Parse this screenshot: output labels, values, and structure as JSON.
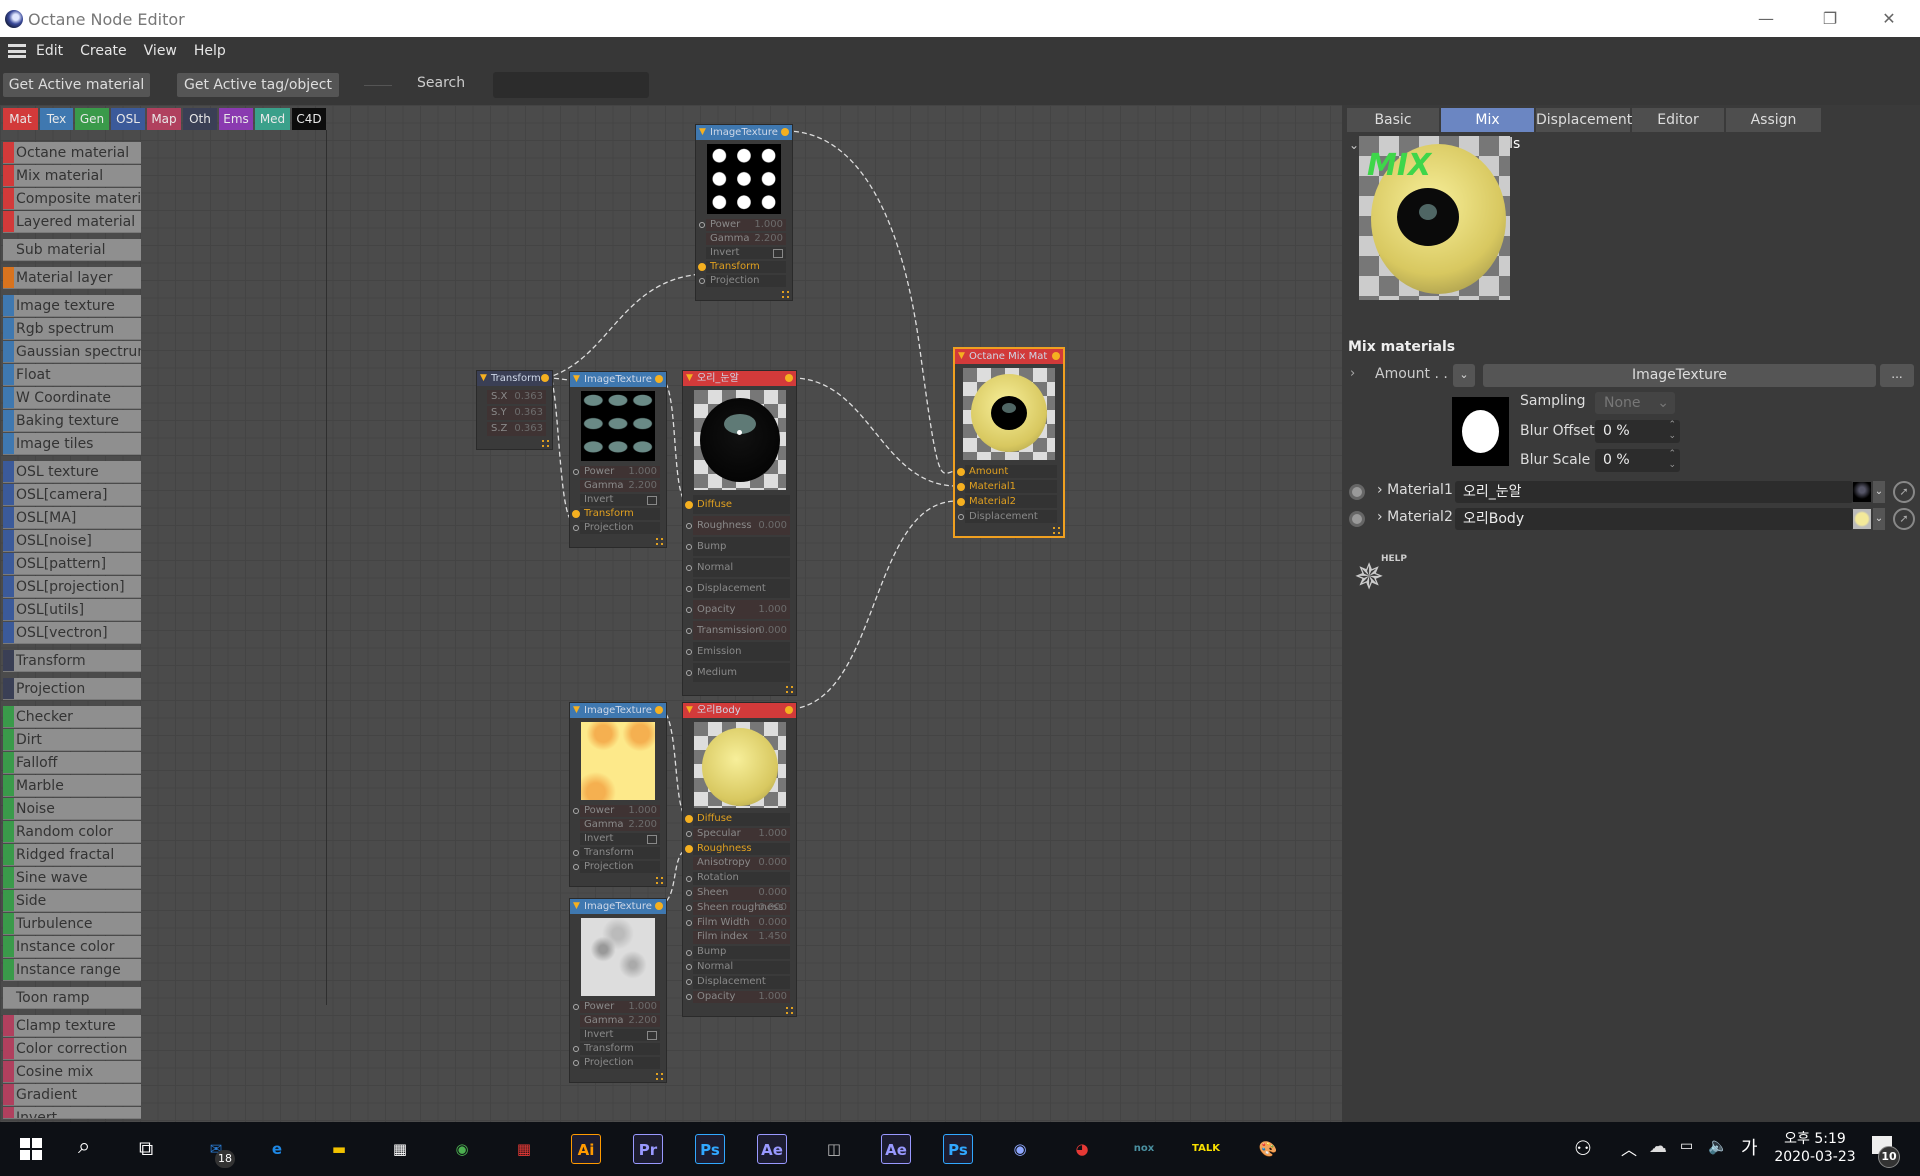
{
  "window": {
    "title": "Octane Node Editor",
    "minimize": "—",
    "restore": "❐",
    "close": "✕"
  },
  "menu": [
    "Edit",
    "Create",
    "View",
    "Help"
  ],
  "toolbar": {
    "get_active_material": "Get Active material",
    "get_active_tag": "Get Active tag/object",
    "search_label": "Search",
    "search_value": ""
  },
  "categories": [
    {
      "label": "Mat",
      "color": "#d23a3a"
    },
    {
      "label": "Tex",
      "color": "#3f78b0"
    },
    {
      "label": "Gen",
      "color": "#3a9a4a"
    },
    {
      "label": "OSL",
      "color": "#3b5a9a"
    },
    {
      "label": "Map",
      "color": "#b0405e"
    },
    {
      "label": "Oth",
      "color": "#3a3f55"
    },
    {
      "label": "Ems",
      "color": "#8a3ab0"
    },
    {
      "label": "Med",
      "color": "#3aa08a"
    },
    {
      "label": "C4D",
      "color": "#0c0c0c"
    }
  ],
  "sidebar": [
    {
      "color": "#d23a3a",
      "items": [
        "Octane material",
        "Mix material",
        "Composite material",
        "Layered material"
      ]
    },
    {
      "color": "",
      "items": [
        "Sub material"
      ]
    },
    {
      "color": "#d8731e",
      "items": [
        "Material layer"
      ]
    },
    {
      "color": "#3f78b0",
      "items": [
        "Image texture",
        "Rgb spectrum",
        "Gaussian spectrum",
        "Float",
        "W Coordinate",
        "Baking texture",
        "Image tiles"
      ]
    },
    {
      "color": "#3b5a9a",
      "items": [
        "OSL texture",
        "OSL[camera]",
        "OSL[MA]",
        "OSL[noise]",
        "OSL[pattern]",
        "OSL[projection]",
        "OSL[utils]",
        "OSL[vectron]"
      ]
    },
    {
      "color": "#3a3f55",
      "items": [
        "Transform"
      ]
    },
    {
      "color": "#3a3f55",
      "items": [
        "Projection"
      ]
    },
    {
      "color": "#3a9a4a",
      "items": [
        "Checker",
        "Dirt",
        "Falloff",
        "Marble",
        "Noise",
        "Random color",
        "Ridged fractal",
        "Sine wave",
        "Side",
        "Turbulence",
        "Instance color",
        "Instance range"
      ]
    },
    {
      "color": "",
      "items": [
        "Toon ramp"
      ]
    },
    {
      "color": "#b0405e",
      "items": [
        "Clamp texture",
        "Color correction",
        "Cosine mix",
        "Gradient",
        "Invert"
      ]
    }
  ],
  "nodes": [
    {
      "id": "tex-dots",
      "title": "ImageTexture",
      "header": "#3f78b0",
      "preview": "dots-white",
      "params": [
        {
          "label": "Power",
          "value": "1.000",
          "port": true
        },
        {
          "label": "Gamma",
          "value": "2.200"
        },
        {
          "label": "Invert",
          "checkbox": true
        },
        {
          "label": "Transform",
          "port": true,
          "active": true
        },
        {
          "label": "Projection",
          "port": true
        }
      ]
    },
    {
      "id": "transform",
      "title": "Transform",
      "header": "#3a3f55",
      "params": [
        {
          "label": "S.X",
          "value": "0.363"
        },
        {
          "label": "S.Y",
          "value": "0.363"
        },
        {
          "label": "S.Z",
          "value": "0.363"
        }
      ]
    },
    {
      "id": "tex-eyes",
      "title": "ImageTexture",
      "header": "#3f78b0",
      "preview": "dots-teal",
      "params": [
        {
          "label": "Power",
          "value": "1.000",
          "port": true
        },
        {
          "label": "Gamma",
          "value": "2.200"
        },
        {
          "label": "Invert",
          "checkbox": true
        },
        {
          "label": "Transform",
          "port": true,
          "active": true
        },
        {
          "label": "Projection",
          "port": true
        }
      ]
    },
    {
      "id": "mat-eye",
      "title": "오리_눈알",
      "header": "#d23a3a",
      "preview": "eyeball",
      "params": [
        {
          "label": "Diffuse",
          "port": true,
          "active": true
        },
        {
          "label": "Roughness",
          "value": "0.000",
          "port": true
        },
        {
          "label": "Bump",
          "port": true
        },
        {
          "label": "Normal",
          "port": true
        },
        {
          "label": "Displacement",
          "port": true
        },
        {
          "label": "Opacity",
          "value": "1.000",
          "port": true
        },
        {
          "label": "Transmission",
          "value": "0.000",
          "port": true
        },
        {
          "label": "Emission",
          "port": true
        },
        {
          "label": "Medium",
          "port": true
        }
      ]
    },
    {
      "id": "mix",
      "title": "Octane Mix Mat",
      "header": "#d23a3a",
      "preview": "mixball",
      "selected": true,
      "params": [
        {
          "label": "Amount",
          "port": true,
          "active": true
        },
        {
          "label": "Material1",
          "port": true,
          "active": true
        },
        {
          "label": "Material2",
          "port": true,
          "active": true
        },
        {
          "label": "Displacement",
          "port": true
        }
      ]
    },
    {
      "id": "tex-yellow",
      "title": "ImageTexture",
      "header": "#3f78b0",
      "preview": "yellow-tex",
      "params": [
        {
          "label": "Power",
          "value": "1.000",
          "port": true
        },
        {
          "label": "Gamma",
          "value": "2.200"
        },
        {
          "label": "Invert",
          "checkbox": true
        },
        {
          "label": "Transform",
          "port": true
        },
        {
          "label": "Projection",
          "port": true
        }
      ]
    },
    {
      "id": "mat-body",
      "title": "오리Body",
      "header": "#d23a3a",
      "preview": "yellowball",
      "params": [
        {
          "label": "Diffuse",
          "port": true,
          "active": true
        },
        {
          "label": "Specular",
          "value": "1.000",
          "port": true
        },
        {
          "label": "Roughness",
          "port": true,
          "active": true
        },
        {
          "label": "Anisotropy",
          "value": "0.000"
        },
        {
          "label": "Rotation",
          "port": true
        },
        {
          "label": "Sheen",
          "value": "0.000",
          "port": true
        },
        {
          "label": "Sheen roughness",
          "value": "0.000",
          "port": true
        },
        {
          "label": "Film Width",
          "value": "0.000",
          "port": true
        },
        {
          "label": "Film index",
          "value": "1.450"
        },
        {
          "label": "Bump",
          "port": true
        },
        {
          "label": "Normal",
          "port": true
        },
        {
          "label": "Displacement",
          "port": true
        },
        {
          "label": "Opacity",
          "value": "1.000",
          "port": true
        }
      ]
    },
    {
      "id": "tex-marble",
      "title": "ImageTexture",
      "header": "#3f78b0",
      "preview": "marble",
      "params": [
        {
          "label": "Power",
          "value": "1.000",
          "port": true
        },
        {
          "label": "Gamma",
          "value": "2.200"
        },
        {
          "label": "Invert",
          "checkbox": true
        },
        {
          "label": "Transform",
          "port": true
        },
        {
          "label": "Projection",
          "port": true
        }
      ]
    }
  ],
  "right_panel": {
    "tabs": [
      {
        "label": "Basic"
      },
      {
        "label": "Mix materials",
        "active": true
      },
      {
        "label": "Displacement"
      },
      {
        "label": "Editor"
      },
      {
        "label": "Assign"
      }
    ],
    "preview_label": "MIX",
    "section_title": "Mix materials",
    "amount": {
      "label": "Amount . .",
      "texture": "ImageTexture",
      "more": "..."
    },
    "sampling": {
      "label": "Sampling",
      "value": "None"
    },
    "blur_offset": {
      "label": "Blur Offset",
      "value": "0 %"
    },
    "blur_scale": {
      "label": "Blur Scale",
      "value": "0 %"
    },
    "material1": {
      "label": "Material1",
      "value": "오리_눈알"
    },
    "material2": {
      "label": "Material2",
      "value": "오리Body"
    },
    "help_label": "HELP"
  },
  "taskbar": {
    "apps": [
      {
        "name": "mail",
        "label": "✉",
        "color": "#2b7cd3",
        "badge": "18"
      },
      {
        "name": "edge",
        "label": "e",
        "color": "#1e88e5"
      },
      {
        "name": "explorer",
        "label": "▬",
        "color": "#f2c200"
      },
      {
        "name": "store",
        "label": "▦",
        "color": "#fff"
      },
      {
        "name": "map-app",
        "label": "◉",
        "color": "#4caf50"
      },
      {
        "name": "grid-app",
        "label": "▦",
        "color": "#e53935"
      },
      {
        "name": "illustrator",
        "label": "Ai",
        "color": "#ff9a00"
      },
      {
        "name": "premiere",
        "label": "Pr",
        "color": "#9999ff"
      },
      {
        "name": "photoshop",
        "label": "Ps",
        "color": "#31a8ff"
      },
      {
        "name": "after-effects",
        "label": "Ae",
        "color": "#9999ff"
      },
      {
        "name": "notion-app",
        "label": "◫",
        "color": "#bbb"
      },
      {
        "name": "after-effects-2",
        "label": "Ae",
        "color": "#9999ff"
      },
      {
        "name": "photoshop-2",
        "label": "Ps",
        "color": "#31a8ff"
      },
      {
        "name": "cinema4d",
        "label": "◉",
        "color": "#8fa8ff"
      },
      {
        "name": "chrome",
        "label": "◕",
        "color": "#e53935"
      },
      {
        "name": "nox",
        "label": "nox",
        "color": "#4a90a0"
      },
      {
        "name": "kakaotalk",
        "label": "TALK",
        "color": "#f9e000"
      },
      {
        "name": "paint",
        "label": "🎨",
        "color": "#ddd"
      }
    ],
    "ime": "가",
    "time": "오후 5:19",
    "date": "2020-03-23",
    "notifications": "10"
  }
}
